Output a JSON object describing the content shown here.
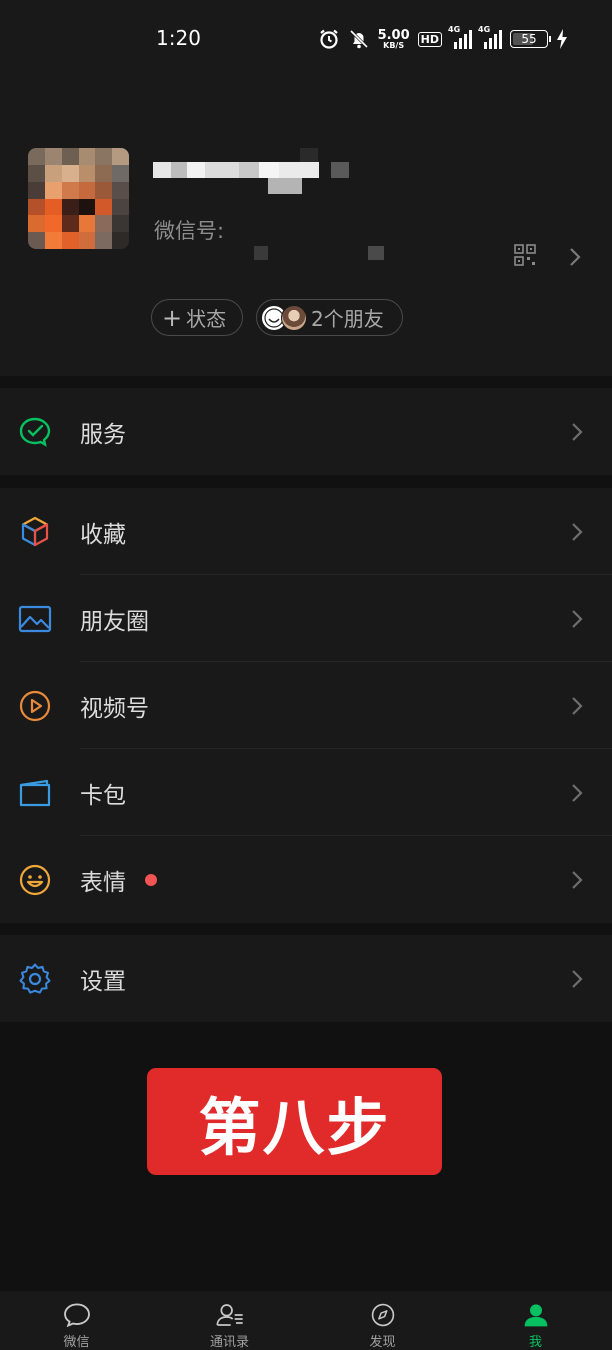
{
  "status_bar": {
    "time": "1:20",
    "net_speed": "5.00",
    "net_unit": "KB/S",
    "hd": "HD",
    "sim1": "4G",
    "sim2": "4G",
    "battery": "55"
  },
  "profile": {
    "wechat_id_label": "微信号:",
    "status_chip": "状态",
    "status_plus": "+",
    "friends_chip": "2个朋友"
  },
  "menu": {
    "services": "服务",
    "favorites": "收藏",
    "moments": "朋友圈",
    "channels": "视频号",
    "cards": "卡包",
    "stickers": "表情",
    "settings": "设置"
  },
  "overlay": {
    "step_text": "第八步"
  },
  "bottom_nav": {
    "tabs": [
      {
        "icon": "chat-bubble-icon",
        "label": "微信",
        "active": false
      },
      {
        "icon": "contacts-icon",
        "label": "通讯录",
        "active": false
      },
      {
        "icon": "compass-icon",
        "label": "发现",
        "active": false
      },
      {
        "icon": "person-icon",
        "label": "我",
        "active": true
      }
    ]
  },
  "colors": {
    "background": "#111111",
    "panel": "#191919",
    "accent_green": "#07c160",
    "step_red": "#e12b2b",
    "notification_dot": "#f25353"
  }
}
